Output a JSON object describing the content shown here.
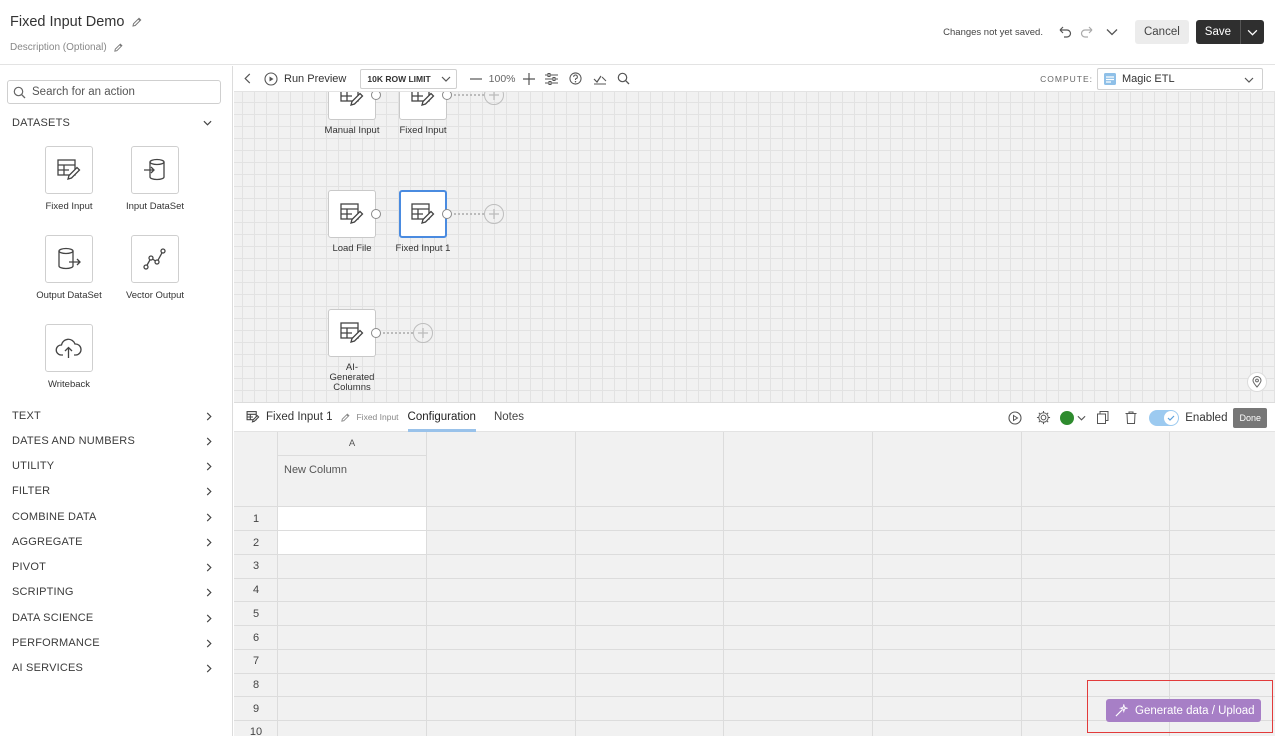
{
  "header": {
    "title": "Fixed Input Demo",
    "description_placeholder": "Description (Optional)",
    "status": "Changes not yet saved.",
    "cancel_label": "Cancel",
    "save_label": "Save"
  },
  "sidebar": {
    "search_placeholder": "Search for an action",
    "datasets_heading": "DATASETS",
    "tiles": [
      {
        "label": "Fixed Input",
        "icon": "fixed-input-icon"
      },
      {
        "label": "Input DataSet",
        "icon": "input-dataset-icon"
      },
      {
        "label": "Output DataSet",
        "icon": "output-dataset-icon"
      },
      {
        "label": "Vector Output",
        "icon": "vector-output-icon"
      },
      {
        "label": "Writeback",
        "icon": "cloud-upload-icon"
      }
    ],
    "categories": [
      "TEXT",
      "DATES AND NUMBERS",
      "UTILITY",
      "FILTER",
      "COMBINE DATA",
      "AGGREGATE",
      "PIVOT",
      "SCRIPTING",
      "DATA SCIENCE",
      "PERFORMANCE",
      "AI SERVICES"
    ]
  },
  "toolbar": {
    "run_preview": "Run Preview",
    "row_limit": "10K ROW LIMIT",
    "zoom": "100%",
    "compute_label": "COMPUTE:",
    "compute_value": "Magic ETL"
  },
  "canvas": {
    "nodes": [
      {
        "label": "Manual Input",
        "icon": "fixed-input-icon"
      },
      {
        "label": "Fixed Input",
        "icon": "fixed-input-icon"
      },
      {
        "label": "Load File",
        "icon": "fixed-input-icon"
      },
      {
        "label": "Fixed Input 1",
        "icon": "fixed-input-icon",
        "selected": true
      },
      {
        "label": "AI-Generated Columns",
        "icon": "fixed-input-icon"
      }
    ]
  },
  "editor": {
    "tile_name": "Fixed Input 1",
    "tile_type": "Fixed Input",
    "tabs": [
      "Configuration",
      "Notes"
    ],
    "active_tab": "Configuration",
    "enabled_label": "Enabled",
    "enabled": true,
    "done_label": "Done",
    "status_color": "#2e8b2e"
  },
  "grid": {
    "column_letter": "A",
    "column_name": "New Column",
    "row_numbers": [
      "1",
      "2",
      "3",
      "4",
      "5",
      "6",
      "7",
      "8",
      "9",
      "10"
    ]
  },
  "generate": {
    "label": "Generate data / Upload",
    "color": "#a77fc6"
  }
}
